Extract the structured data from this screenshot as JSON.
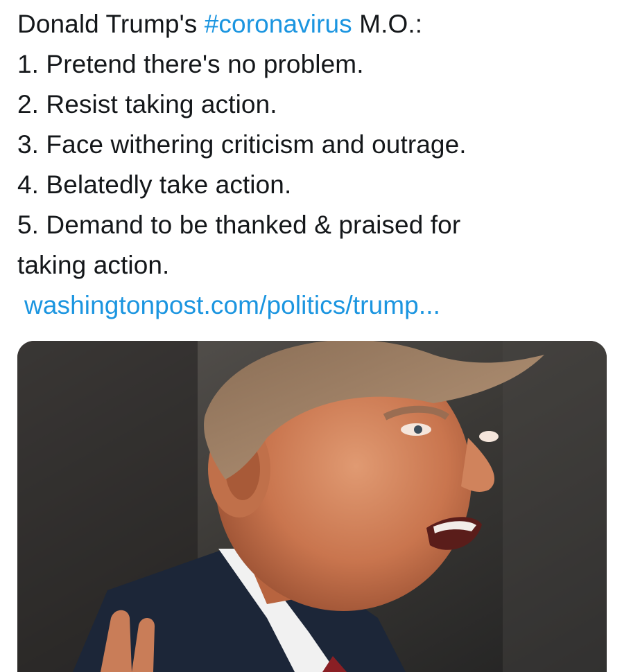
{
  "tweet": {
    "intro_before": "Donald Trump's ",
    "hashtag": "#coronavirus",
    "intro_after": " M.O.:",
    "items": [
      "1. Pretend there's no problem.",
      "2. Resist taking action.",
      "3. Face withering criticism and outrage.",
      "4. Belatedly take action.",
      "5. Demand to be thanked & praised for",
      "taking action."
    ],
    "link": "washingtonpost.com/politics/trump..."
  },
  "media": {
    "icon": "photo-of-man-speaking"
  },
  "colors": {
    "text": "#14171a",
    "link": "#1b95e0",
    "background": "#ffffff"
  }
}
